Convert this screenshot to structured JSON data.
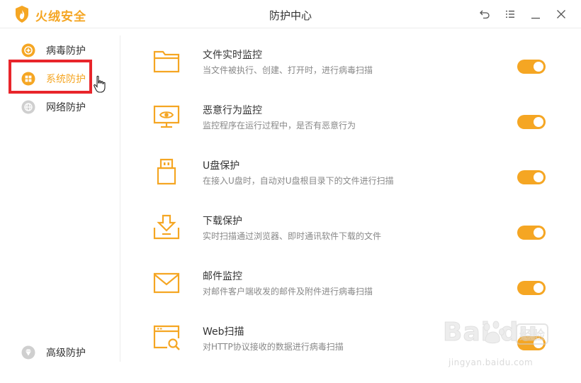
{
  "app": {
    "name": "火绒安全",
    "window_title": "防护中心",
    "accent_color": "#f5a623"
  },
  "titlebar_buttons": [
    {
      "name": "back-icon"
    },
    {
      "name": "menu-icon"
    },
    {
      "name": "minimize-icon"
    },
    {
      "name": "close-icon"
    }
  ],
  "sidebar": {
    "items": [
      {
        "label": "病毒防护",
        "icon": "virus-protection-icon",
        "active": false
      },
      {
        "label": "系统防护",
        "icon": "system-protection-icon",
        "active": true
      },
      {
        "label": "网络防护",
        "icon": "network-protection-icon",
        "active": false
      },
      {
        "label": "高级防护",
        "icon": "advanced-protection-icon",
        "active": false
      }
    ]
  },
  "features": [
    {
      "title": "文件实时监控",
      "desc": "当文件被执行、创建、打开时，进行病毒扫描",
      "icon": "folder-icon",
      "enabled": true
    },
    {
      "title": "恶意行为监控",
      "desc": "监控程序在运行过程中，是否有恶意行为",
      "icon": "monitor-eye-icon",
      "enabled": true
    },
    {
      "title": "U盘保护",
      "desc": "在接入U盘时，自动对U盘根目录下的文件进行扫描",
      "icon": "usb-drive-icon",
      "enabled": true
    },
    {
      "title": "下载保护",
      "desc": "实时扫描通过浏览器、即时通讯软件下载的文件",
      "icon": "download-icon",
      "enabled": true
    },
    {
      "title": "邮件监控",
      "desc": "对邮件客户端收发的邮件及附件进行病毒扫描",
      "icon": "mail-icon",
      "enabled": true
    },
    {
      "title": "Web扫描",
      "desc": "对HTTP协议接收的数据进行病毒扫描",
      "icon": "web-scan-icon",
      "enabled": true
    }
  ],
  "watermark": {
    "brand": "Bai  du",
    "badge": "经验",
    "url": "jingyan.baidu.com"
  }
}
